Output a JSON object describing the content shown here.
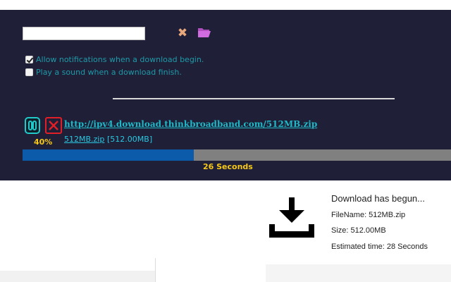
{
  "download_form": {
    "url_input_value": "",
    "clear_icon": "close-x-icon",
    "folder_icon": "open-folder-icon"
  },
  "options": [
    {
      "label": "Allow notifications when a download begin.",
      "checked": true
    },
    {
      "label": "Play a sound when a download finish.",
      "checked": false
    }
  ],
  "active_download": {
    "url": "http://ipv4.download.thinkbroadband.com/512MB.zip",
    "file_name": "512MB.zip",
    "size_label": "[512.00MB]",
    "percent_label": "40%",
    "progress": 0.4,
    "time_remaining": "26 Seconds",
    "pause_icon": "pause-icon",
    "cancel_icon": "cancel-icon"
  },
  "notification": {
    "icon": "download-tray-icon",
    "title": "Download has begun...",
    "file_name_line": "FileName: 512MB.zip",
    "size_line": "Size: 512.00MB",
    "time_line": "Estimated time: 28 Seconds"
  },
  "colors": {
    "panel_bg": "#1f1f37",
    "accent_teal": "#1fb8c6",
    "accent_yellow": "#f7c818",
    "progress_fill": "#0c5bab",
    "progress_track": "#808080",
    "cancel_red": "#e01f26"
  }
}
